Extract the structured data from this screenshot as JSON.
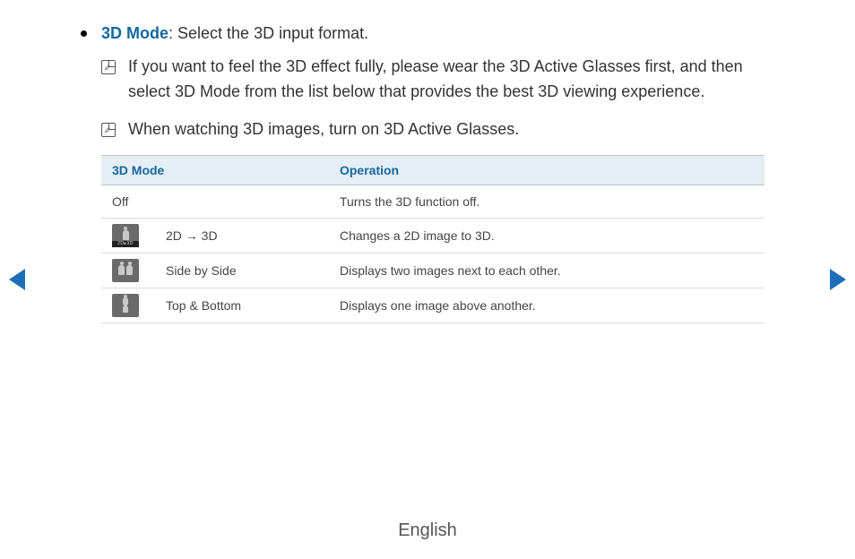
{
  "heading": {
    "term": "3D Mode",
    "desc": ": Select the 3D input format."
  },
  "notes": [
    "If you want to feel the 3D effect fully, please wear the 3D Active Glasses first, and then select 3D Mode from the list below that provides the best 3D viewing experience.",
    "When watching 3D images, turn on 3D Active Glasses."
  ],
  "table": {
    "headers": {
      "mode": "3D Mode",
      "op": "Operation"
    },
    "rows": [
      {
        "icon": null,
        "mode": "Off",
        "op": "Turns the 3D function off."
      },
      {
        "icon": "2d3d",
        "mode": "2D → 3D",
        "op": "Changes a 2D image to 3D."
      },
      {
        "icon": "sbs",
        "mode": "Side by Side",
        "op": "Displays two images next to each other."
      },
      {
        "icon": "tb",
        "mode": "Top & Bottom",
        "op": "Displays one image above another."
      }
    ]
  },
  "footer": "English"
}
